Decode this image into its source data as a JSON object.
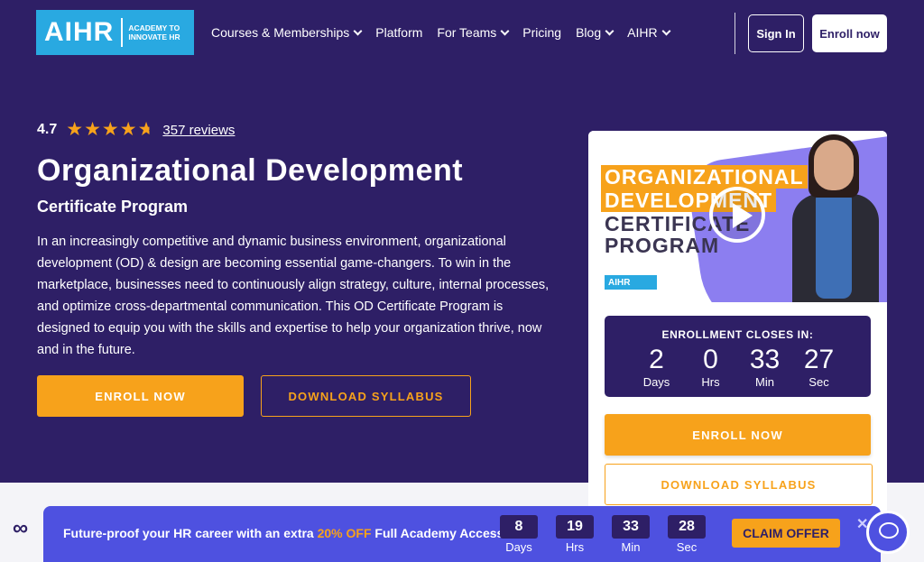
{
  "nav": {
    "logo_main": "AIHR",
    "logo_sub_line1": "ACADEMY TO",
    "logo_sub_line2": "INNOVATE HR",
    "menu": [
      {
        "label": "Courses & Memberships",
        "dropdown": true
      },
      {
        "label": "Platform",
        "dropdown": false
      },
      {
        "label": "For Teams",
        "dropdown": true
      },
      {
        "label": "Pricing",
        "dropdown": false
      },
      {
        "label": "Blog",
        "dropdown": true
      },
      {
        "label": "AIHR",
        "dropdown": true
      }
    ],
    "signin_label": "Sign In",
    "enroll_label": "Enroll now"
  },
  "hero": {
    "rating": "4.7",
    "rating_value": 4.7,
    "rating_max": 5,
    "reviews": "357 reviews",
    "title": "Organizational Development",
    "subtitle": "Certificate Program",
    "description": "In an increasingly competitive and dynamic business environment, organizational development (OD) & design are becoming essential game-changers. To win in the marketplace, businesses need to continuously align strategy, culture, internal processes, and optimize cross-departmental communication. This OD Certificate Program is designed to equip you with the skills and expertise to help your organization thrive, now and in the future.",
    "enroll_button": "ENROLL NOW",
    "syllabus_button": "DOWNLOAD SYLLABUS"
  },
  "card": {
    "video_title_1": "ORGANIZATIONAL",
    "video_title_2": "DEVELOPMENT",
    "video_title_3": "CERTIFICATE",
    "video_title_4": "PROGRAM",
    "video_logo": "AIHR",
    "enrollment_label": "ENROLLMENT CLOSES IN:",
    "countdown": [
      {
        "value": "2",
        "unit": "Days"
      },
      {
        "value": "0",
        "unit": "Hrs"
      },
      {
        "value": "33",
        "unit": "Min"
      },
      {
        "value": "27",
        "unit": "Sec"
      }
    ],
    "enroll_button": "ENROLL NOW",
    "syllabus_button": "DOWNLOAD SYLLABUS"
  },
  "promo": {
    "text_before": "Future-proof your HR career with an extra ",
    "highlight": "20% OFF",
    "text_after": " Full Academy Access.",
    "countdown": [
      {
        "value": "8",
        "unit": "Days"
      },
      {
        "value": "19",
        "unit": "Hrs"
      },
      {
        "value": "33",
        "unit": "Min"
      },
      {
        "value": "28",
        "unit": "Sec"
      }
    ],
    "claim_button": "CLAIM OFFER",
    "close_glyph": "✕"
  },
  "colors": {
    "brand_purple": "#2e1f66",
    "accent_orange": "#f7a21b",
    "logo_blue": "#29a9e1",
    "promo_blue": "#4e51e0"
  },
  "icons": {
    "star": "star-icon",
    "chevron": "chevron-down-icon",
    "play": "play-icon",
    "meta": "meta-icon",
    "chat": "chat-icon",
    "close": "close-icon"
  },
  "meta_glyph": "∞"
}
